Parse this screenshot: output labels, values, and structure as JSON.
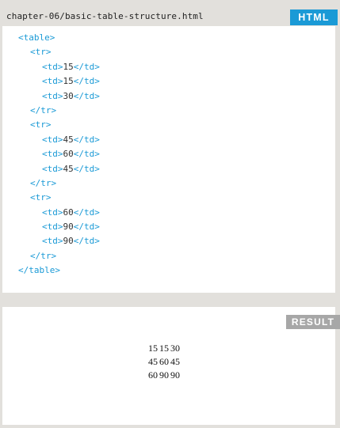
{
  "code_panel": {
    "file_path": "chapter-06/basic-table-structure.html",
    "language_badge": "HTML",
    "lines": [
      {
        "indent": 0,
        "open": "<table>",
        "text": "",
        "close": ""
      },
      {
        "indent": 1,
        "open": "<tr>",
        "text": "",
        "close": ""
      },
      {
        "indent": 2,
        "open": "<td>",
        "text": "15",
        "close": "</td>"
      },
      {
        "indent": 2,
        "open": "<td>",
        "text": "15",
        "close": "</td>"
      },
      {
        "indent": 2,
        "open": "<td>",
        "text": "30",
        "close": "</td>"
      },
      {
        "indent": 1,
        "open": "</tr>",
        "text": "",
        "close": ""
      },
      {
        "indent": 1,
        "open": "<tr>",
        "text": "",
        "close": ""
      },
      {
        "indent": 2,
        "open": "<td>",
        "text": "45",
        "close": "</td>"
      },
      {
        "indent": 2,
        "open": "<td>",
        "text": "60",
        "close": "</td>"
      },
      {
        "indent": 2,
        "open": "<td>",
        "text": "45",
        "close": "</td>"
      },
      {
        "indent": 1,
        "open": "</tr>",
        "text": "",
        "close": ""
      },
      {
        "indent": 1,
        "open": "<tr>",
        "text": "",
        "close": ""
      },
      {
        "indent": 2,
        "open": "<td>",
        "text": "60",
        "close": "</td>"
      },
      {
        "indent": 2,
        "open": "<td>",
        "text": "90",
        "close": "</td>"
      },
      {
        "indent": 2,
        "open": "<td>",
        "text": "90",
        "close": "</td>"
      },
      {
        "indent": 1,
        "open": "</tr>",
        "text": "",
        "close": ""
      },
      {
        "indent": 0,
        "open": "</table>",
        "text": "",
        "close": ""
      }
    ]
  },
  "result_panel": {
    "badge": "RESULT",
    "table_rows": [
      [
        "15",
        "15",
        "30"
      ],
      [
        "45",
        "60",
        "45"
      ],
      [
        "60",
        "90",
        "90"
      ]
    ]
  },
  "colors": {
    "tag_color": "#1a9ad6",
    "html_badge_bg": "#1a9ad6",
    "result_badge_bg": "#a7a7a7",
    "page_bg": "#e2e0dc"
  }
}
